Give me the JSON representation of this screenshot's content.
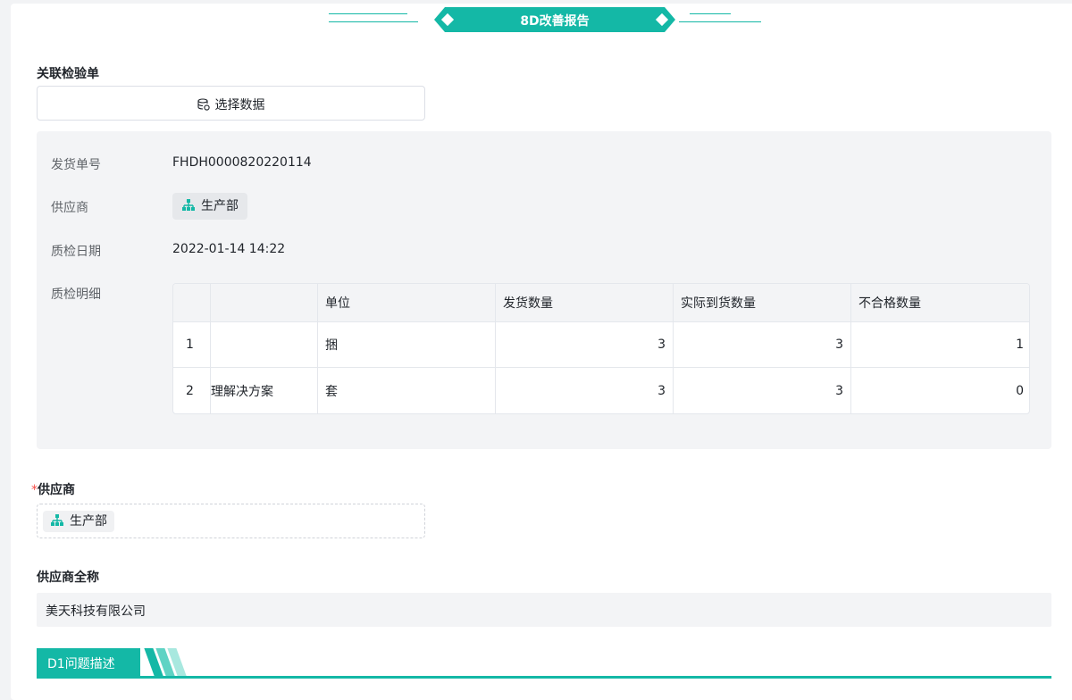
{
  "header": {
    "title": "8D改善报告"
  },
  "inspection": {
    "label": "关联检验单",
    "select_button": "选择数据",
    "fields": {
      "delivery_no_label": "发货单号",
      "delivery_no": "FHDH0000820220114",
      "supplier_label": "供应商",
      "supplier": "生产部",
      "inspect_date_label": "质检日期",
      "inspect_date": "2022-01-14 14:22",
      "detail_label": "质检明细"
    },
    "table": {
      "headers": [
        "",
        "",
        "单位",
        "发货数量",
        "实际到货数量",
        "不合格数量"
      ],
      "rows": [
        [
          "1",
          "",
          "捆",
          "3",
          "3",
          "1"
        ],
        [
          "2",
          "理解决方案",
          "套",
          "3",
          "3",
          "0"
        ]
      ]
    }
  },
  "supplier_field": {
    "required_mark": "*",
    "label": "供应商",
    "value": "生产部"
  },
  "supplier_fullname": {
    "label": "供应商全称",
    "value": "美天科技有限公司"
  },
  "section": {
    "title": "D1问题描述"
  },
  "colors": {
    "accent": "#14b8a6",
    "required": "#f54a45"
  }
}
